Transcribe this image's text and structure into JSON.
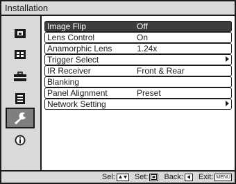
{
  "window": {
    "title": "Installation"
  },
  "sidebar": {
    "items": [
      {
        "icon": "picture-icon",
        "active": false
      },
      {
        "icon": "screen-icon",
        "active": false
      },
      {
        "icon": "toolbox-icon",
        "active": false
      },
      {
        "icon": "list-icon",
        "active": false
      },
      {
        "icon": "wrench-icon",
        "active": true
      },
      {
        "icon": "info-icon",
        "active": false
      }
    ]
  },
  "menu": {
    "items": [
      {
        "label": "Image Flip",
        "value": "Off",
        "submenu": false,
        "selected": true
      },
      {
        "label": "Lens Control",
        "value": "On",
        "submenu": false,
        "selected": false
      },
      {
        "label": "Anamorphic Lens",
        "value": "1.24x",
        "submenu": false,
        "selected": false
      },
      {
        "label": "Trigger Select",
        "value": "",
        "submenu": true,
        "selected": false
      },
      {
        "label": "IR Receiver",
        "value": "Front & Rear",
        "submenu": false,
        "selected": false
      },
      {
        "label": "Blanking",
        "value": "",
        "submenu": false,
        "selected": false
      },
      {
        "label": "Panel Alignment",
        "value": "Preset",
        "submenu": false,
        "selected": false
      },
      {
        "label": "Network Setting",
        "value": "",
        "submenu": true,
        "selected": false
      }
    ]
  },
  "statusbar": {
    "sel_label": "Sel:",
    "set_label": "Set:",
    "back_label": "Back:",
    "exit_label": "Exit:",
    "exit_key": "MENU"
  },
  "colors": {
    "panel_gray": "#d9d9d9",
    "selected_row": "#3d3d3d",
    "active_icon": "#7f7f7f",
    "outline": "#1a1a1a"
  }
}
